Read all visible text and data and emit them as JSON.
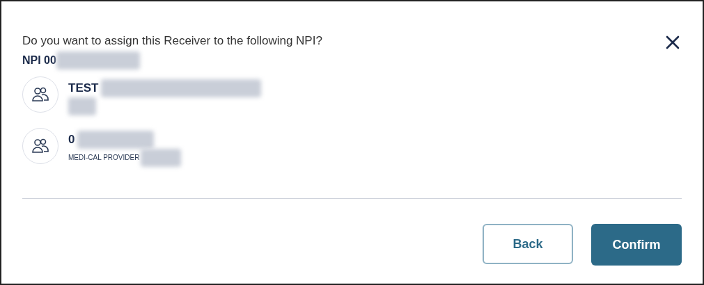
{
  "dialog": {
    "question": "Do you want to assign this Receiver to the following NPI?",
    "npi": "NPI 00",
    "entries": [
      {
        "name": "TEST"
      },
      {
        "name": "0",
        "subtitle": "MEDI-CAL PROVIDER"
      }
    ],
    "buttons": [
      {
        "label": "Back",
        "kind": "secondary"
      },
      {
        "label": "Confirm",
        "kind": "primary"
      }
    ]
  }
}
